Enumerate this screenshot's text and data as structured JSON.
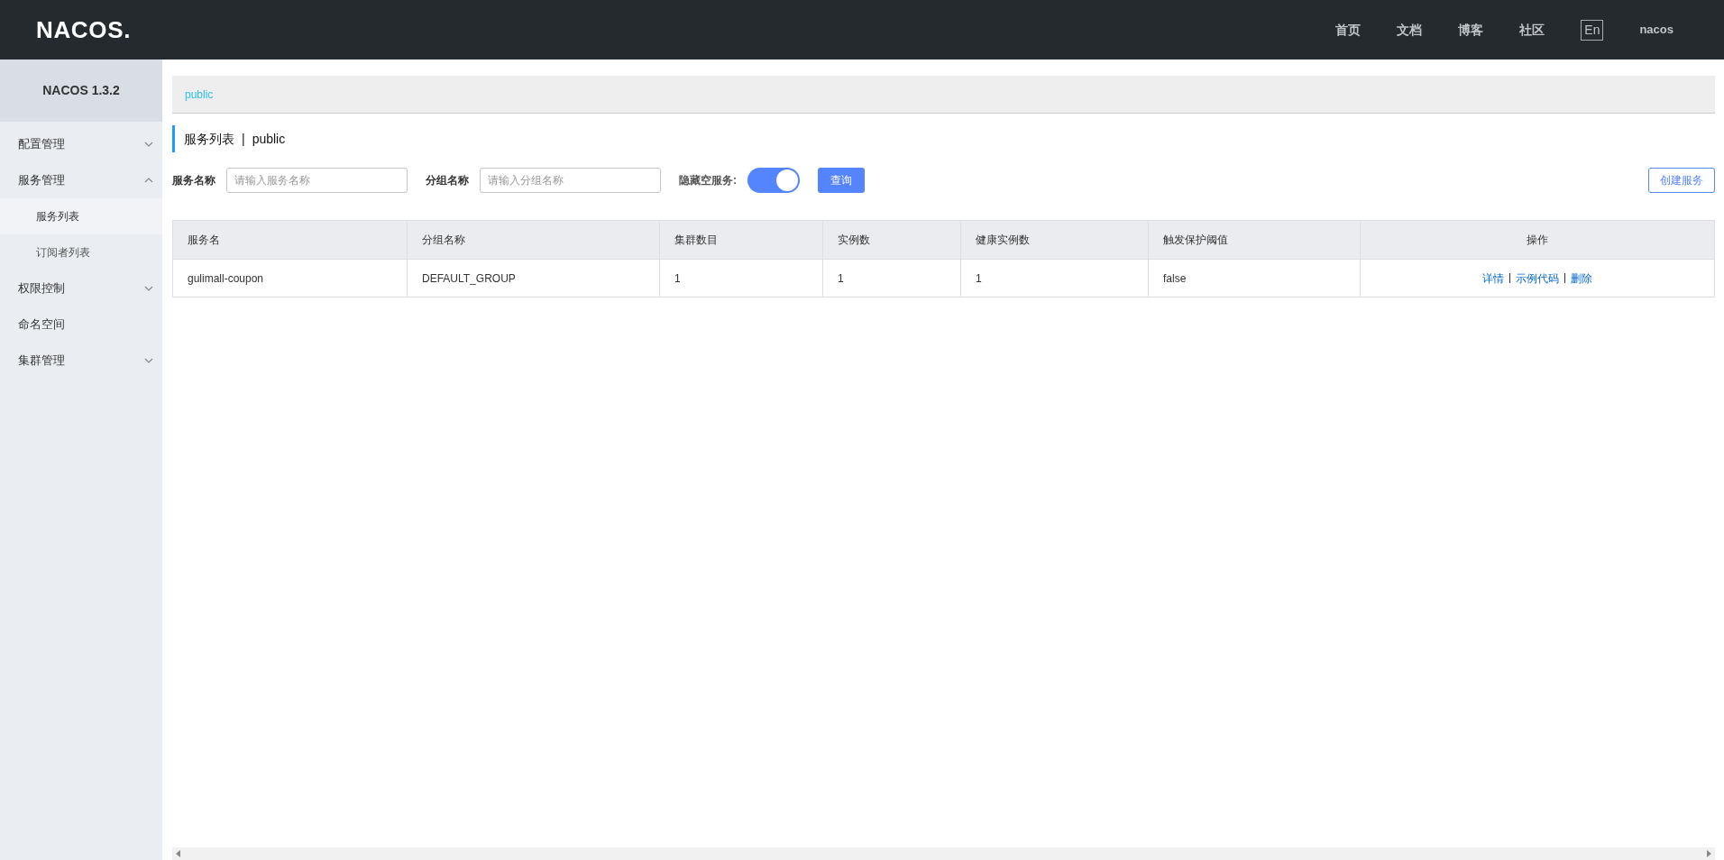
{
  "header": {
    "logo": "NACOS.",
    "nav": [
      "首页",
      "文档",
      "博客",
      "社区"
    ],
    "language": "En",
    "user": "nacos"
  },
  "sidebar": {
    "title": "NACOS 1.3.2",
    "items": [
      {
        "label": "配置管理",
        "expandable": true,
        "expanded": false,
        "selected": false
      },
      {
        "label": "服务管理",
        "expandable": true,
        "expanded": true,
        "selected": false,
        "children": [
          {
            "label": "服务列表",
            "selected": true
          },
          {
            "label": "订阅者列表",
            "selected": false
          }
        ]
      },
      {
        "label": "权限控制",
        "expandable": true,
        "expanded": false,
        "selected": false
      },
      {
        "label": "命名空间",
        "expandable": false,
        "selected": false
      },
      {
        "label": "集群管理",
        "expandable": true,
        "expanded": false,
        "selected": false
      }
    ]
  },
  "namespace_bar": {
    "tabs": [
      {
        "label": "public",
        "selected": true
      }
    ]
  },
  "page_title": {
    "title": "服务列表",
    "separator": "|",
    "namespace": "public"
  },
  "filters": {
    "service_name": {
      "label": "服务名称",
      "placeholder": "请输入服务名称"
    },
    "group_name": {
      "label": "分组名称",
      "placeholder": "请输入分组名称"
    },
    "hide_empty": {
      "label": "隐藏空服务:",
      "on": true
    },
    "query_button": "查询",
    "create_button": "创建服务"
  },
  "table": {
    "columns": [
      "服务名",
      "分组名称",
      "集群数目",
      "实例数",
      "健康实例数",
      "触发保护阈值",
      "操作"
    ],
    "rows": [
      {
        "cells": [
          "gulimall-coupon",
          "DEFAULT_GROUP",
          "1",
          "1",
          "1",
          "false"
        ],
        "actions": [
          "详情",
          "示例代码",
          "删除"
        ]
      }
    ]
  }
}
